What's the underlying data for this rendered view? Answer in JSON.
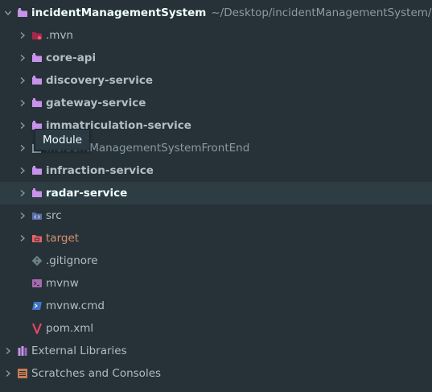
{
  "root": {
    "name": "incidentManagementSystem",
    "path": "~/Desktop/incidentManagementSystem/i"
  },
  "items": [
    {
      "label": ".mvn"
    },
    {
      "label": "core-api"
    },
    {
      "label": "discovery-service"
    },
    {
      "label": "gateway-service"
    },
    {
      "label": "immatriculation-service"
    },
    {
      "label": "incidentManagementSystemFrontEnd"
    },
    {
      "label": "infraction-service"
    },
    {
      "label": "radar-service"
    },
    {
      "label": "src"
    },
    {
      "label": "target"
    },
    {
      "label": ".gitignore"
    },
    {
      "label": "mvnw"
    },
    {
      "label": "mvnw.cmd"
    },
    {
      "label": "pom.xml"
    }
  ],
  "external_libraries": {
    "label": "External Libraries"
  },
  "scratches": {
    "label": "Scratches and Consoles"
  },
  "tooltip": {
    "text": "Module"
  },
  "colors": {
    "background": "#263238",
    "selected_row": "#2e3c43",
    "module_folder": "#c792ea",
    "excluded_folder": "#ec5f67",
    "source_folder": "#82aaff"
  }
}
